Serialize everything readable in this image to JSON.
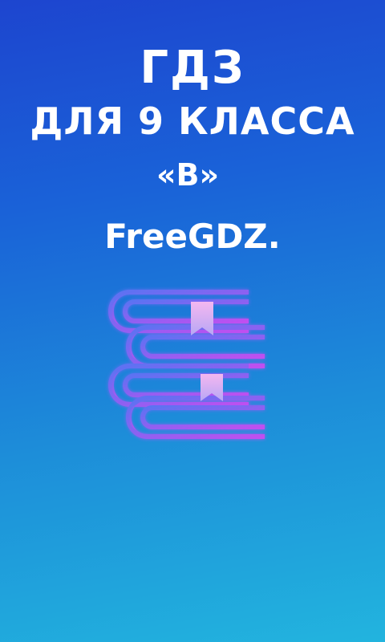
{
  "splash": {
    "title_line_1": "ГДЗ",
    "title_line_2": "ДЛЯ 9 КЛАССА",
    "title_line_3": "«В»",
    "brand": "FreeGDZ."
  },
  "icons": {
    "logo": "stack-of-books-icon"
  },
  "colors": {
    "background_top": "#1d45cf",
    "background_bottom": "#22b4de",
    "text": "#ffffff",
    "icon_gradient_start": "#5a73f2",
    "icon_gradient_end": "#c04ff0"
  }
}
